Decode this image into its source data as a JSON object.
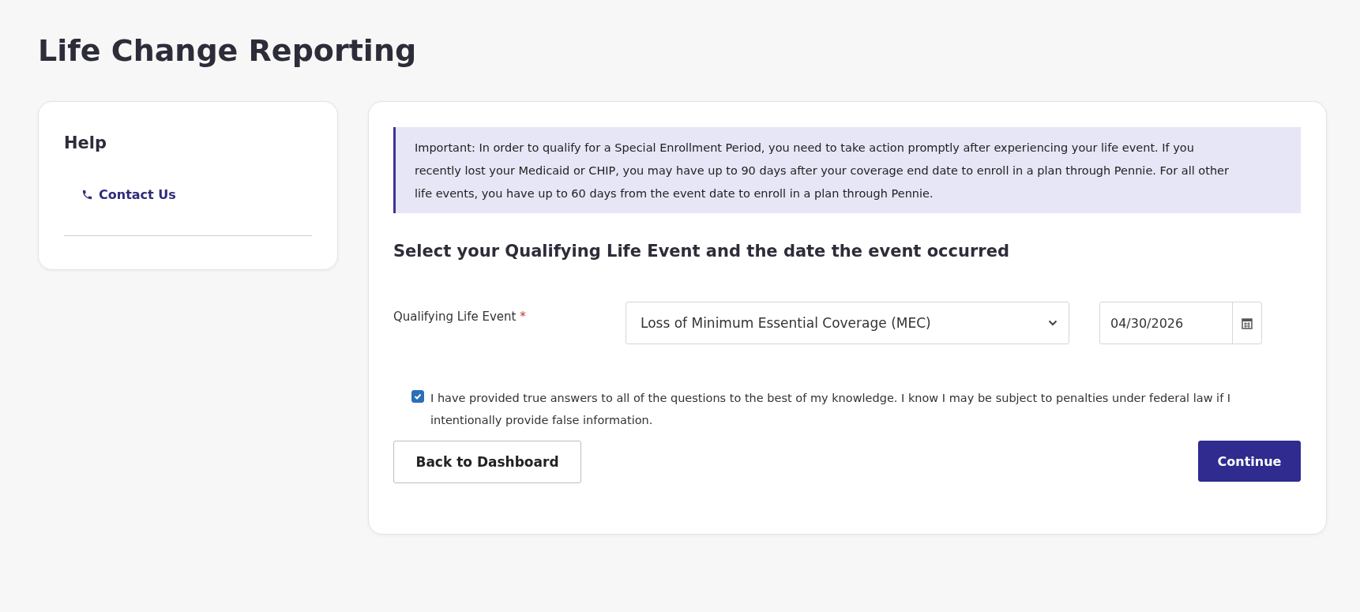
{
  "page": {
    "title": "Life Change Reporting"
  },
  "help": {
    "title": "Help",
    "links": [
      {
        "label": "Contact Us"
      }
    ]
  },
  "notice": "Important: In order to qualify for a Special Enrollment Period, you need to take action promptly after experiencing your life event. If you recently lost your Medicaid or CHIP, you may have up to 90 days after your coverage end date to enroll in a plan through Pennie. For all other life events, you have up to 60 days from the event date to enroll in a plan through Pennie.",
  "form": {
    "heading": "Select your Qualifying Life Event and the date the event occurred",
    "event_label": "Qualifying Life Event",
    "required_mark": "*",
    "event_value": "Loss of Minimum Essential Coverage (MEC)",
    "date_value": "04/30/2026",
    "attestation": {
      "text": "I have provided true answers to all of the questions to the best of my knowledge. I know I may be subject to penalties under federal law if I intentionally provide false information.",
      "checked": true
    }
  },
  "buttons": [
    {
      "label": "Back to Dashboard",
      "kind": "secondary"
    },
    {
      "label": "Continue",
      "kind": "primary"
    }
  ]
}
